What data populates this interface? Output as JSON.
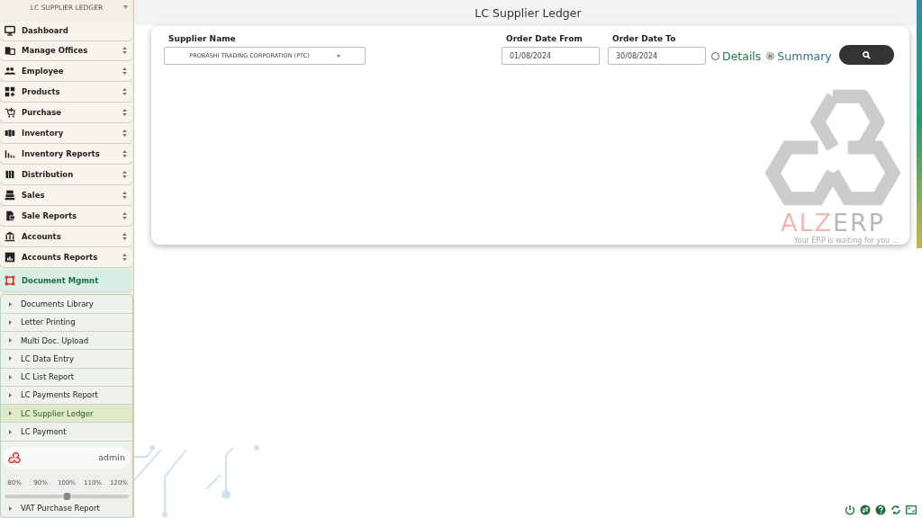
{
  "sidebar": {
    "header": "LC SUPPLIER LEDGER",
    "menu": [
      {
        "label": "Dashboard",
        "expandable": false,
        "expanded": false
      },
      {
        "label": "Manage Offices",
        "expandable": true,
        "expanded": false
      },
      {
        "label": "Employee",
        "expandable": true,
        "expanded": false
      },
      {
        "label": "Products",
        "expandable": true,
        "expanded": false
      },
      {
        "label": "Purchase",
        "expandable": true,
        "expanded": false
      },
      {
        "label": "Inventory",
        "expandable": true,
        "expanded": false
      },
      {
        "label": "Inventory Reports",
        "expandable": true,
        "expanded": false
      },
      {
        "label": "Distribution",
        "expandable": true,
        "expanded": false
      },
      {
        "label": "Sales",
        "expandable": true,
        "expanded": false
      },
      {
        "label": "Sale Reports",
        "expandable": true,
        "expanded": false
      },
      {
        "label": "Accounts",
        "expandable": true,
        "expanded": false
      },
      {
        "label": "Accounts Reports",
        "expandable": true,
        "expanded": false
      },
      {
        "label": "Document Mgmnt",
        "expandable": false,
        "expanded": true
      }
    ],
    "submenu": [
      {
        "label": "Documents Library",
        "selected": false
      },
      {
        "label": "Letter Printing",
        "selected": false
      },
      {
        "label": "Multi Doc. Upload",
        "selected": false
      },
      {
        "label": "LC Data Entry",
        "selected": false
      },
      {
        "label": "LC List Report",
        "selected": false
      },
      {
        "label": "LC Payments Report",
        "selected": false
      },
      {
        "label": "LC Supplier Ledger",
        "selected": true
      },
      {
        "label": "LC Payment",
        "selected": false
      },
      {
        "label": "VAT Purchase Report",
        "selected": false
      }
    ]
  },
  "user": {
    "name": "admin"
  },
  "zoom": {
    "options": [
      "80%",
      "90%",
      "100%",
      "110%",
      "120%"
    ],
    "level": 0.5
  },
  "page": {
    "title": "LC Supplier Ledger"
  },
  "form": {
    "supplier": {
      "label": "Supplier Name",
      "value": "PROBASHI TRADING CORPORATION (PTC)"
    },
    "date_from": {
      "label": "Order Date From",
      "value": "01/08/2024"
    },
    "date_to": {
      "label": "Order Date To",
      "value": "30/08/2024"
    },
    "report_type": [
      {
        "label": "Details",
        "selected": false
      },
      {
        "label": "Summary",
        "selected": true
      }
    ]
  },
  "brand": {
    "name_part_1": "ALZ",
    "name_part_2": "ERP",
    "tagline": "Your ERP is waiting for you ..."
  }
}
